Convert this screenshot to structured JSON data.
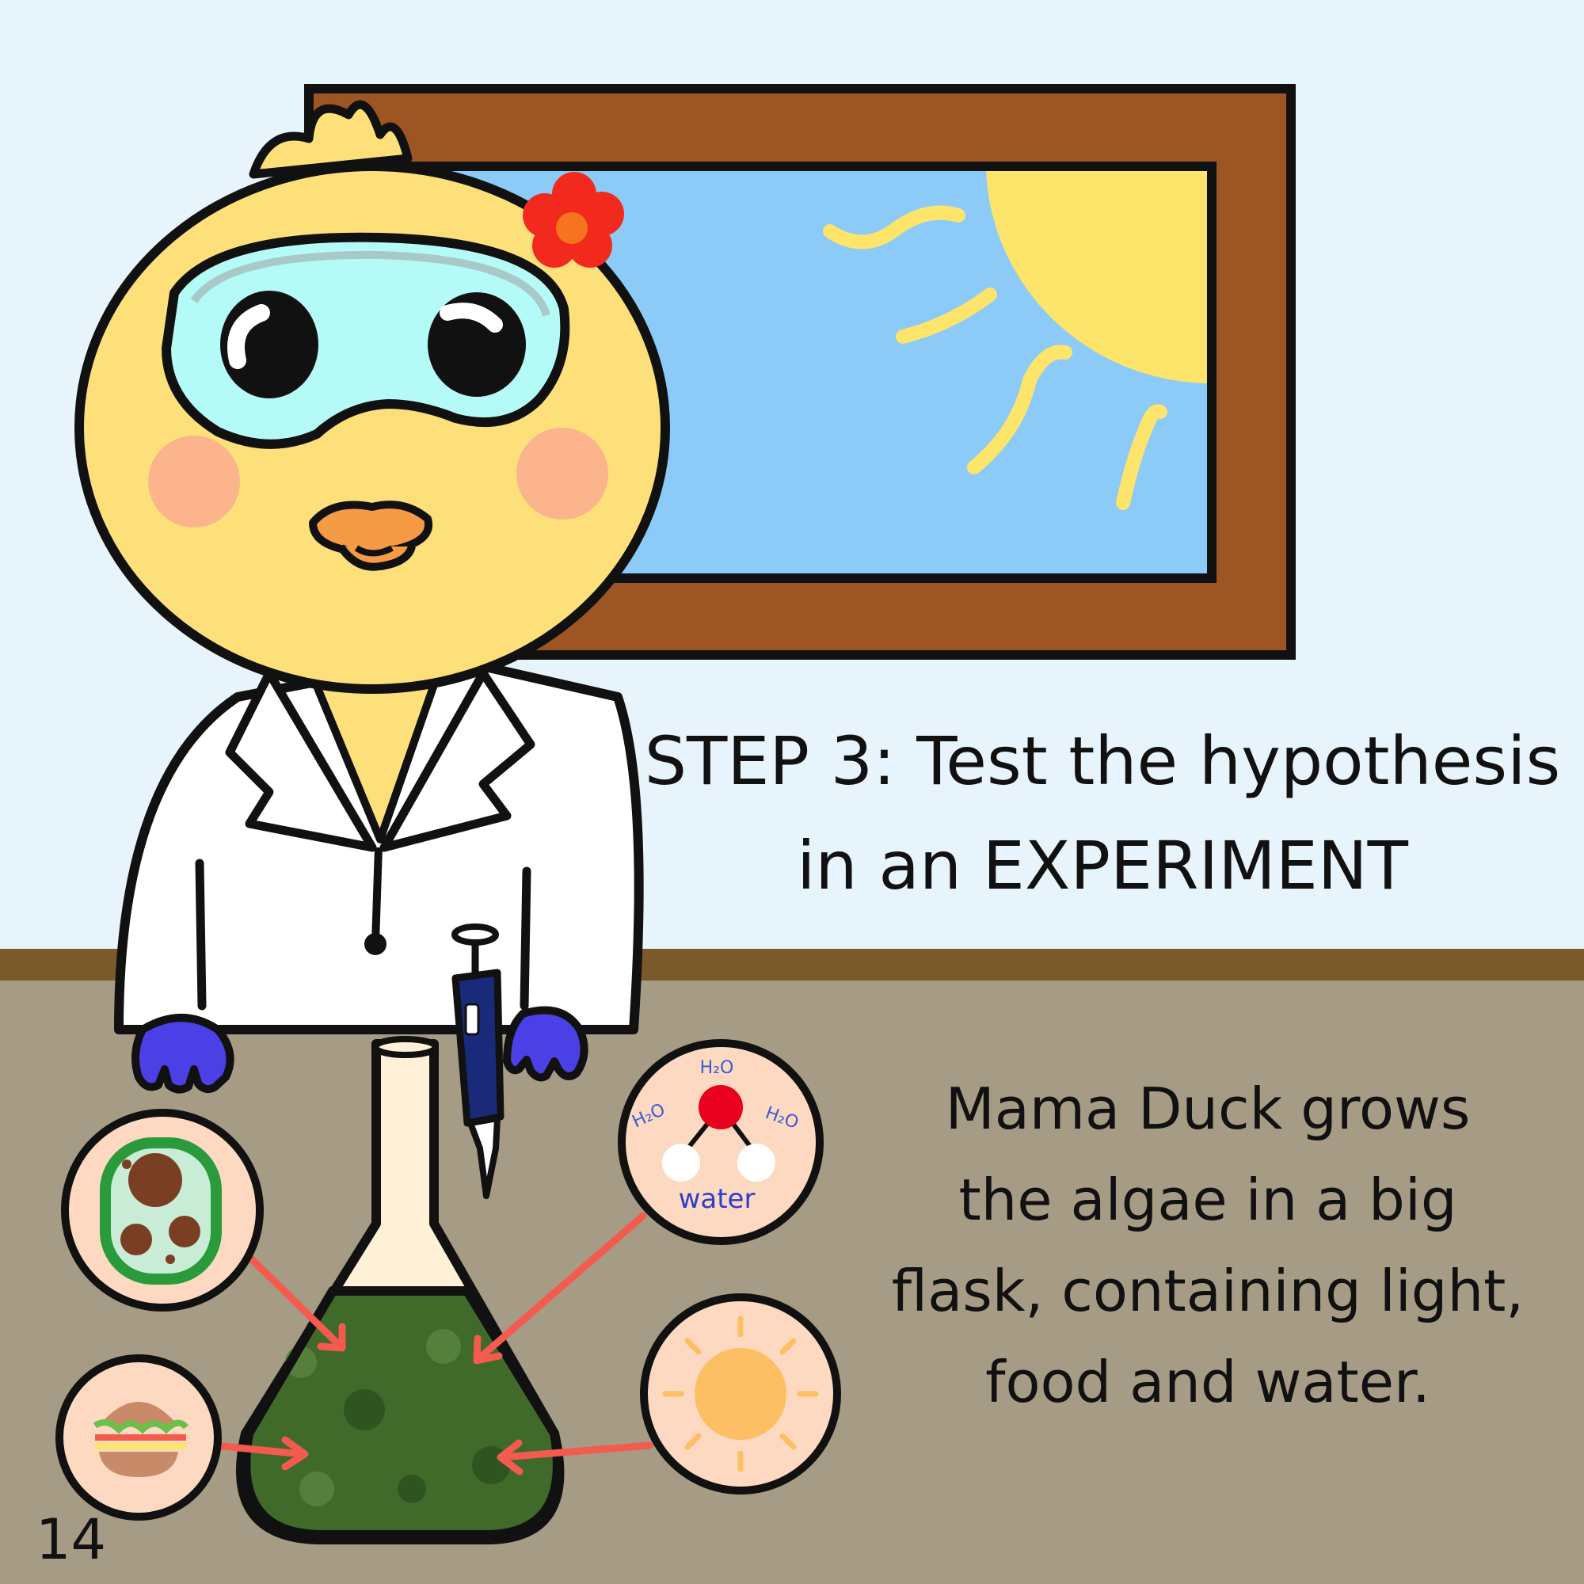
{
  "heading": {
    "line1": "STEP 3: Test the hypothesis",
    "line2": "in an EXPERIMENT"
  },
  "body": {
    "lines": [
      "Mama Duck grows",
      "the algae in a big",
      "flask, containing light,",
      "food and water."
    ]
  },
  "page_number": "14",
  "water_circle": {
    "formula": "H₂O",
    "label": "water"
  },
  "colors": {
    "sky": "#e8f4fb",
    "window_frame": "#9c5523",
    "window_glass": "#8ccbf8",
    "sun": "#fde46a",
    "duck": "#fde07a",
    "beak": "#f59a45",
    "goggles": "#b4fbf8",
    "lab_coat": "#ffffff",
    "gloves": "#4a40e6",
    "table": "#a69b84",
    "table_edge": "#7a5a2a",
    "algae": "#3f6a2a",
    "flower": "#f22a1e",
    "arrow": "#f45a4e",
    "icon_circle": "#fcd9c0"
  },
  "icons": [
    "duck-scientist",
    "window-icon",
    "sun-icon",
    "flower-icon",
    "goggles-icon",
    "pipette-icon",
    "flask-icon",
    "algae-cell-icon",
    "burger-icon",
    "water-molecule-icon",
    "light-sun-icon"
  ]
}
